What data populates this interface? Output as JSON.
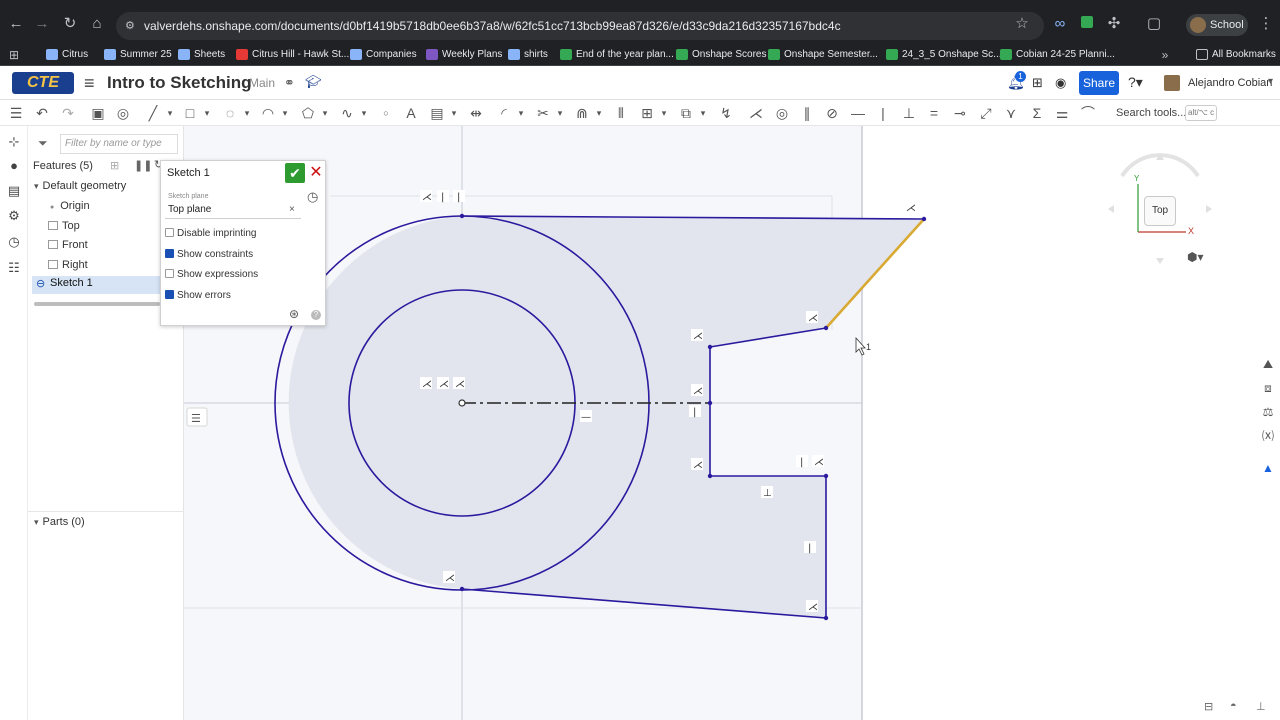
{
  "browser": {
    "url": "valverdehs.onshape.com/documents/d0bf1419b5718db0ee6b37a8/w/62fc51cc713bcb99ea87d326/e/d33c9da216d32357167bdc4c",
    "profile": "School",
    "all_bookmarks": "All Bookmarks",
    "bookmarks": [
      {
        "label": "Citrus",
        "color": "#8ab4f8"
      },
      {
        "label": "Summer 25",
        "color": "#8ab4f8"
      },
      {
        "label": "Sheets",
        "color": "#8ab4f8"
      },
      {
        "label": "Citrus Hill - Hawk St...",
        "color": "#e53935"
      },
      {
        "label": "Companies",
        "color": "#8ab4f8"
      },
      {
        "label": "Weekly Plans",
        "color": "#7e57c2"
      },
      {
        "label": "shirts",
        "color": "#8ab4f8"
      },
      {
        "label": "End of the year plan...",
        "color": "#34a853"
      },
      {
        "label": "Onshape Scores",
        "color": "#34a853"
      },
      {
        "label": "Onshape  Semester...",
        "color": "#34a853"
      },
      {
        "label": "24_3_5 Onshape Sc...",
        "color": "#34a853"
      },
      {
        "label": "Cobian 24-25 Planni...",
        "color": "#34a853"
      }
    ]
  },
  "header": {
    "logo": "CTE",
    "document_title": "Intro to Sketching",
    "branch": "Main",
    "share_label": "Share",
    "user_name": "Alejandro Cobian",
    "notification_count": "1"
  },
  "toolbar": {
    "search_placeholder": "Search tools...",
    "search_shortcut": "alt/⌥ c"
  },
  "feature_panel": {
    "filter_placeholder": "Filter by name or type",
    "features_title": "Features (5)",
    "default_geometry": "Default geometry",
    "items": [
      "Origin",
      "Top",
      "Front",
      "Right"
    ],
    "sketch": "Sketch 1",
    "parts": "Parts (0)"
  },
  "sketch_dialog": {
    "title": "Sketch 1",
    "plane_label": "Sketch plane",
    "plane_value": "Top plane",
    "options": [
      {
        "label": "Disable imprinting",
        "checked": false
      },
      {
        "label": "Show constraints",
        "checked": true
      },
      {
        "label": "Show expressions",
        "checked": false
      },
      {
        "label": "Show errors",
        "checked": true
      }
    ]
  },
  "view_cube": {
    "face": "Top",
    "x_axis": "X",
    "y_axis": "Y"
  },
  "cursor_badge": "1",
  "colors": {
    "sketch_line": "#2a1a9e",
    "highlight_line": "#d8a933",
    "fill": "#e4e6ee",
    "plane": "#f4f6fa",
    "accent": "#1863dc"
  }
}
